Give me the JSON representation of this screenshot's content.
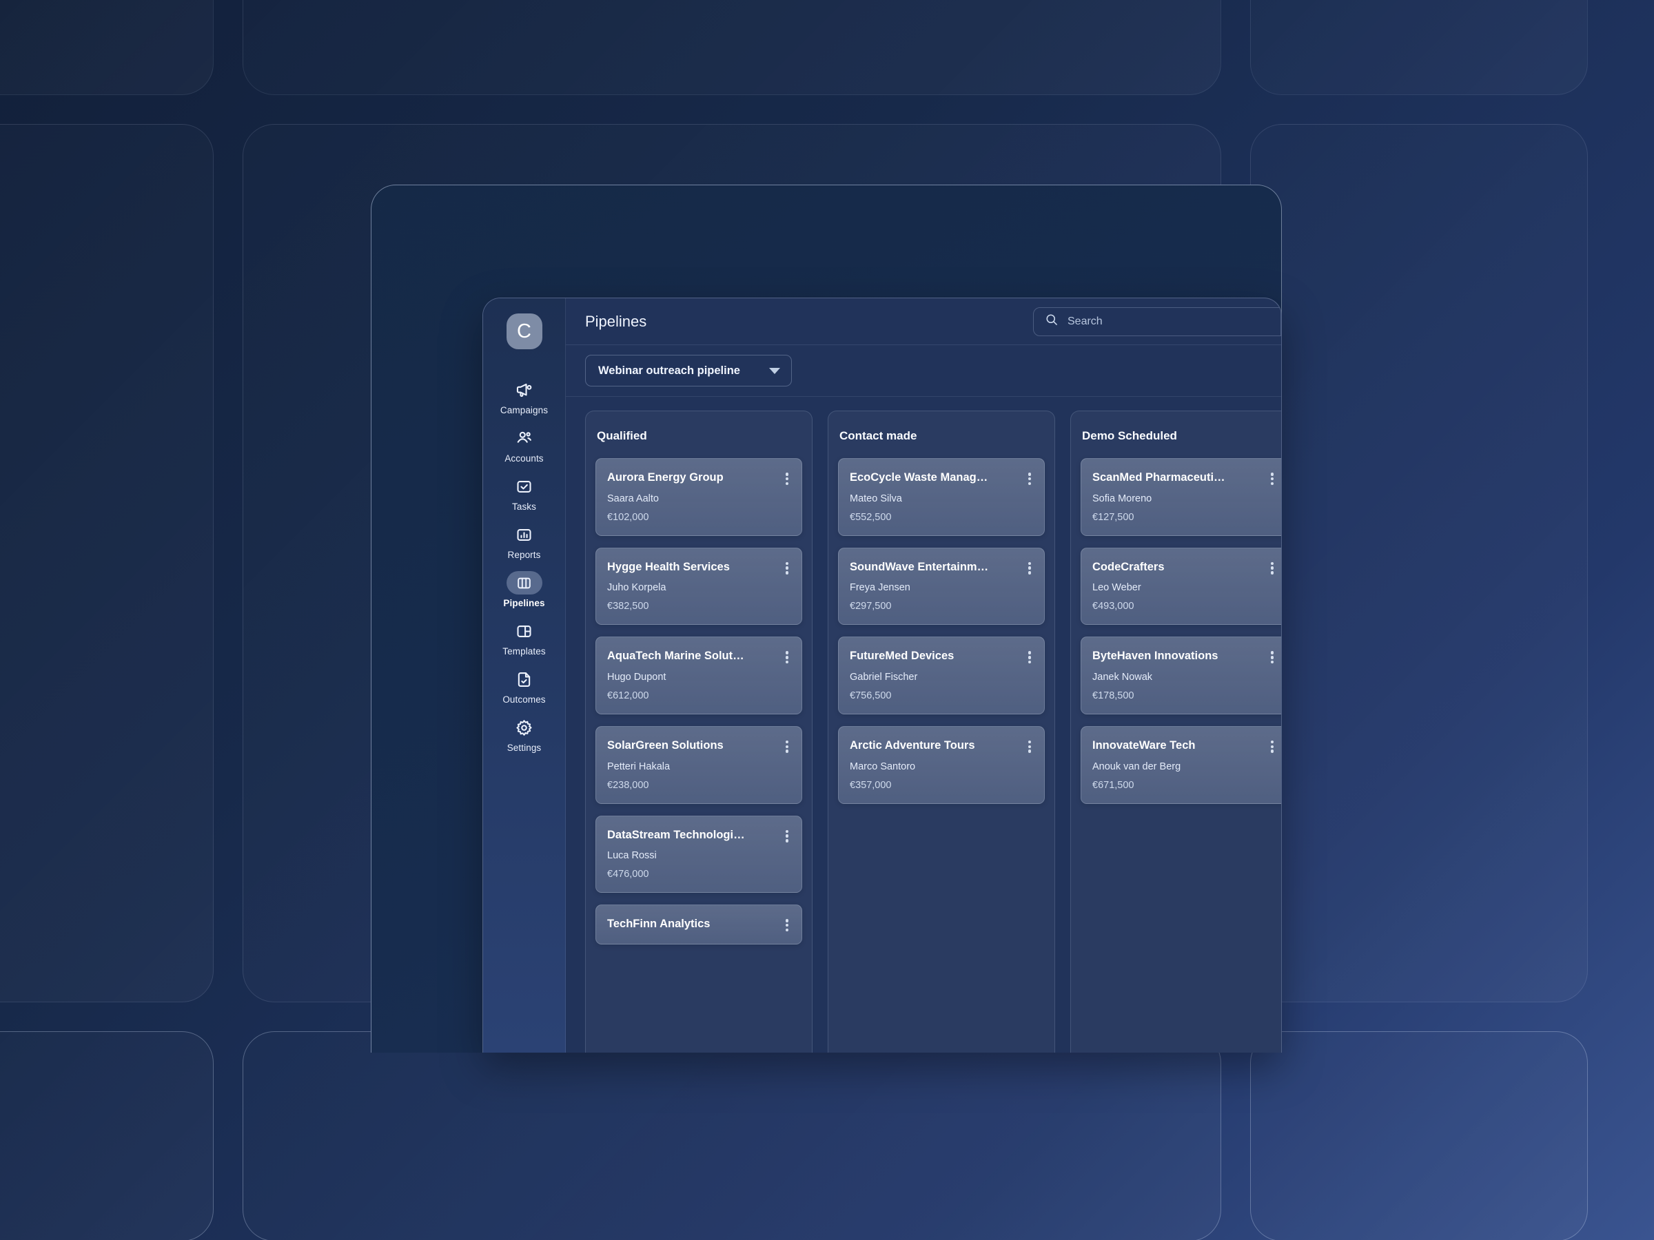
{
  "app": {
    "brand_initial": "C",
    "page_title": "Pipelines"
  },
  "search": {
    "placeholder": "Search",
    "value": "",
    "icon": "search-icon"
  },
  "toolbar": {
    "pipeline_selected": "Webinar outreach pipeline",
    "caret_icon": "chevron-down-icon"
  },
  "sidebar": {
    "items": [
      {
        "label": "Campaigns",
        "icon": "megaphone-icon",
        "active": false
      },
      {
        "label": "Accounts",
        "icon": "users-icon",
        "active": false
      },
      {
        "label": "Tasks",
        "icon": "check-square-icon",
        "active": false
      },
      {
        "label": "Reports",
        "icon": "bar-chart-icon",
        "active": false
      },
      {
        "label": "Pipelines",
        "icon": "columns-icon",
        "active": true
      },
      {
        "label": "Templates",
        "icon": "layout-icon",
        "active": false
      },
      {
        "label": "Outcomes",
        "icon": "file-check-icon",
        "active": false
      },
      {
        "label": "Settings",
        "icon": "gear-icon",
        "active": false
      }
    ]
  },
  "board": {
    "columns": [
      {
        "title": "Qualified",
        "cards": [
          {
            "company": "Aurora Energy Group",
            "contact": "Saara Aalto",
            "amount": "€102,000"
          },
          {
            "company": "Hygge Health Services",
            "contact": "Juho Korpela",
            "amount": "€382,500"
          },
          {
            "company": "AquaTech Marine Solut…",
            "contact": "Hugo Dupont",
            "amount": "€612,000"
          },
          {
            "company": "SolarGreen Solutions",
            "contact": "Petteri Hakala",
            "amount": "€238,000"
          },
          {
            "company": "DataStream Technologi…",
            "contact": "Luca Rossi",
            "amount": "€476,000"
          },
          {
            "company": "TechFinn Analytics",
            "contact": "",
            "amount": ""
          }
        ]
      },
      {
        "title": "Contact made",
        "cards": [
          {
            "company": "EcoCycle Waste Manag…",
            "contact": "Mateo Silva",
            "amount": "€552,500"
          },
          {
            "company": "SoundWave Entertainm…",
            "contact": "Freya Jensen",
            "amount": "€297,500"
          },
          {
            "company": "FutureMed Devices",
            "contact": "Gabriel Fischer",
            "amount": "€756,500"
          },
          {
            "company": "Arctic Adventure Tours",
            "contact": "Marco Santoro",
            "amount": "€357,000"
          }
        ]
      },
      {
        "title": "Demo Scheduled",
        "cards": [
          {
            "company": "ScanMed Pharmaceuti…",
            "contact": "Sofia Moreno",
            "amount": "€127,500"
          },
          {
            "company": "CodeCrafters",
            "contact": "Leo Weber",
            "amount": "€493,000"
          },
          {
            "company": "ByteHaven Innovations",
            "contact": "Janek Nowak",
            "amount": "€178,500"
          },
          {
            "company": "InnovateWare Tech",
            "contact": "Anouk van der Berg",
            "amount": "€671,500"
          }
        ]
      }
    ]
  },
  "colors": {
    "backdrop_dark": "#12203a",
    "backdrop_light": "#3a5490",
    "app_panel": "#21335a",
    "sidebar_top": "#1d3053",
    "sidebar_bottom": "#2b4274",
    "brand_logo": "#7e8ca6",
    "text_primary": "#ffffff",
    "text_muted": "#cfdaec"
  }
}
